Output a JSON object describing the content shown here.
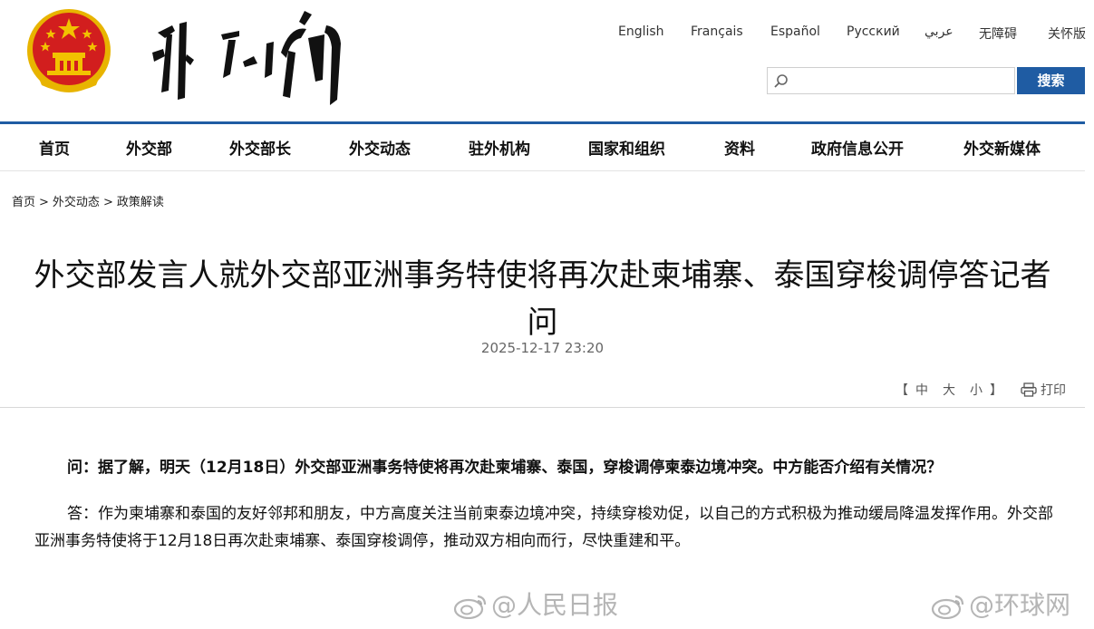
{
  "header": {
    "languages": [
      "English",
      "Français",
      "Español",
      "Русский",
      "عربي",
      "无障碍",
      "关怀版"
    ],
    "search": {
      "placeholder": "",
      "button_label": "搜索"
    }
  },
  "nav": {
    "items": [
      "首页",
      "外交部",
      "外交部长",
      "外交动态",
      "驻外机构",
      "国家和组织",
      "资料",
      "政府信息公开",
      "外交新媒体"
    ]
  },
  "breadcrumb": {
    "items": [
      "首页",
      "外交动态",
      "政策解读"
    ],
    "separator": ">"
  },
  "article": {
    "title": "外交部发言人就外交部亚洲事务特使将再次赴柬埔寨、泰国穿梭调停答记者问",
    "date": "2025-12-17 23:20",
    "font_size_controls": {
      "open": "【",
      "options": [
        "中",
        "大",
        "小"
      ],
      "close": "】"
    },
    "print_label": "打印",
    "question": "问：据了解，明天（12月18日）外交部亚洲事务特使将再次赴柬埔寨、泰国，穿梭调停柬泰边境冲突。中方能否介绍有关情况？",
    "answer": "答：作为柬埔寨和泰国的友好邻邦和朋友，中方高度关注当前柬泰边境冲突，持续穿梭劝促，以自己的方式积极为推动缓局降温发挥作用。外交部亚洲事务特使将于12月18日再次赴柬埔寨、泰国穿梭调停，推动双方相向而行，尽快重建和平。"
  },
  "watermarks": [
    "@人民日报",
    "@环球网"
  ],
  "colors": {
    "accent": "#1f5ca3",
    "emblem_red": "#d21e1e",
    "emblem_gold": "#f2c200"
  }
}
